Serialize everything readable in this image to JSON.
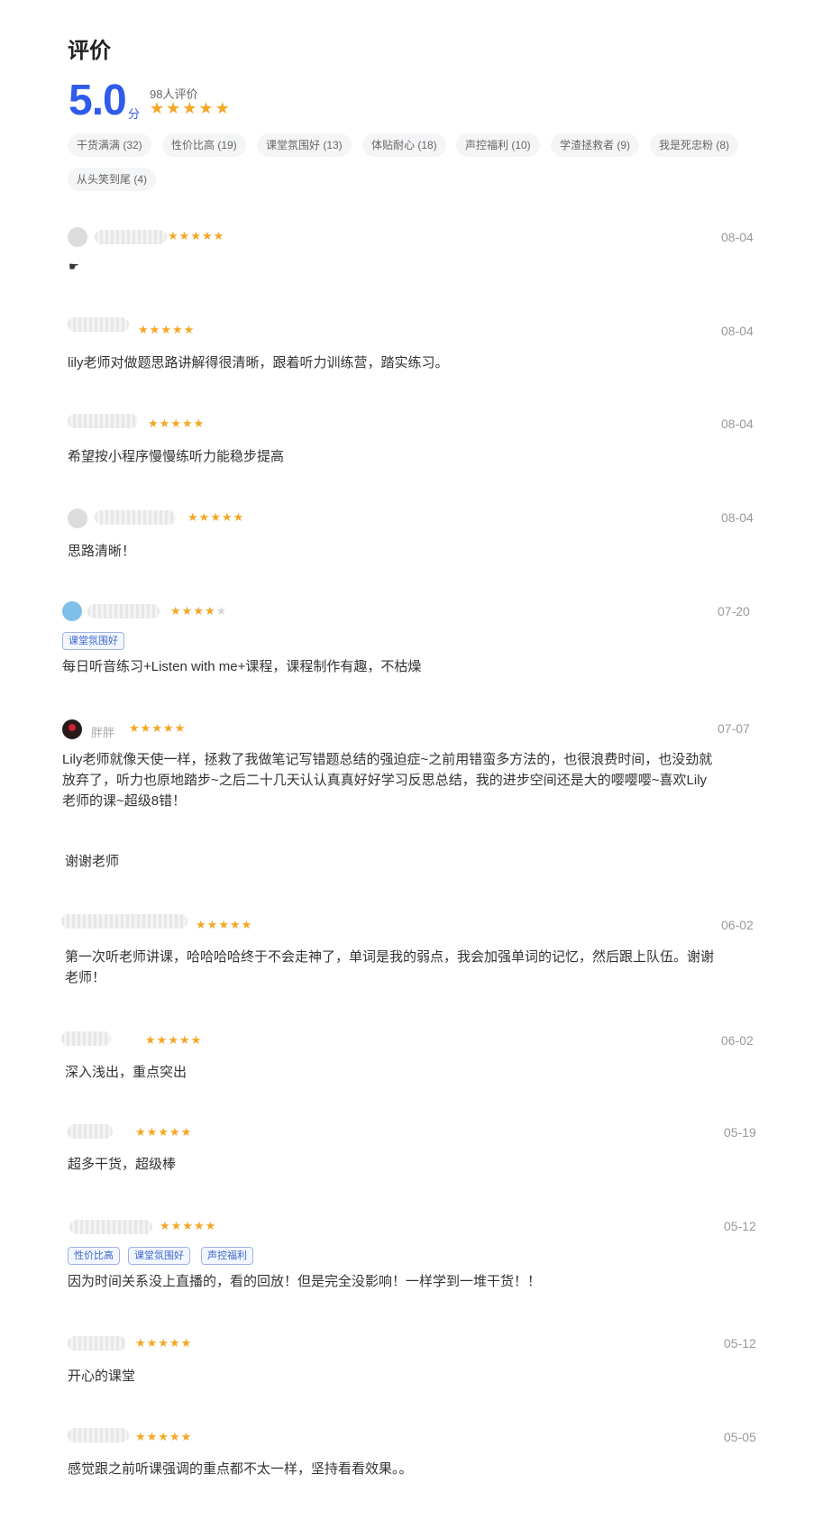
{
  "header": {
    "title": "评价",
    "score": "5.0",
    "score_unit": "分",
    "count": "98人评价"
  },
  "tags": [
    "干货满满 (32)",
    "性价比高 (19)",
    "课堂氛围好 (13)",
    "体贴耐心 (18)",
    "声控福利 (10)",
    "学渣拯救者 (9)",
    "我是死忠粉 (8)",
    "从头笑到尾 (4)"
  ],
  "reviews": [
    {
      "name": "",
      "rating": 5,
      "date": "08-04",
      "text": "",
      "pills": []
    },
    {
      "name": "",
      "rating": 5,
      "date": "08-04",
      "text": "lily老师对做题思路讲解得很清晰，跟着听力训练营，踏实练习。",
      "pills": []
    },
    {
      "name": "",
      "rating": 5,
      "date": "08-04",
      "text": "希望按小程序慢慢练听力能稳步提高",
      "pills": []
    },
    {
      "name": "",
      "rating": 5,
      "date": "08-04",
      "text": "思路清晰！",
      "pills": []
    },
    {
      "name": "",
      "rating": 4,
      "date": "07-20",
      "text": "每日听音练习+Listen with me+课程，课程制作有趣，不枯燥",
      "pills": [
        "课堂氛围好"
      ]
    },
    {
      "name": "胖胖",
      "rating": 5,
      "date": "07-07",
      "text": "Lily老师就像天使一样，拯救了我做笔记写错题总结的强迫症~之前用错蛮多方法的，也很浪费时间，也没劲就放弃了，听力也原地踏步~之后二十几天认认真真好好学习反思总结，我的进步空间还是大的嘤嘤嘤~喜欢Lily老师的课~超级8错！",
      "pills": []
    },
    {
      "name": "",
      "rating": 0,
      "date": "",
      "text": "谢谢老师",
      "pills": []
    },
    {
      "name": "",
      "rating": 5,
      "date": "06-02",
      "text": "第一次听老师讲课，哈哈哈哈终于不会走神了，单词是我的弱点，我会加强单词的记忆，然后跟上队伍。谢谢老师！",
      "pills": []
    },
    {
      "name": "",
      "rating": 5,
      "date": "06-02",
      "text": "深入浅出，重点突出",
      "pills": []
    },
    {
      "name": "",
      "rating": 5,
      "date": "05-19",
      "text": "超多干货，超级棒",
      "pills": []
    },
    {
      "name": "",
      "rating": 5,
      "date": "05-12",
      "text": "因为时间关系没上直播的，看的回放！但是完全没影响！一样学到一堆干货！！",
      "pills": [
        "性价比高",
        "课堂氛围好",
        "声控福利"
      ]
    },
    {
      "name": "",
      "rating": 5,
      "date": "05-12",
      "text": "开心的课堂",
      "pills": []
    },
    {
      "name": "",
      "rating": 5,
      "date": "05-05",
      "text": "感觉跟之前听课强调的重点都不太一样，坚持看看效果。。",
      "pills": []
    }
  ],
  "icons": {
    "star": "star-icon",
    "hand": "pointing-hand-icon"
  },
  "colors": {
    "accent": "#2f5bea",
    "star": "#f5a623",
    "pill_text": "#3d67c9"
  }
}
